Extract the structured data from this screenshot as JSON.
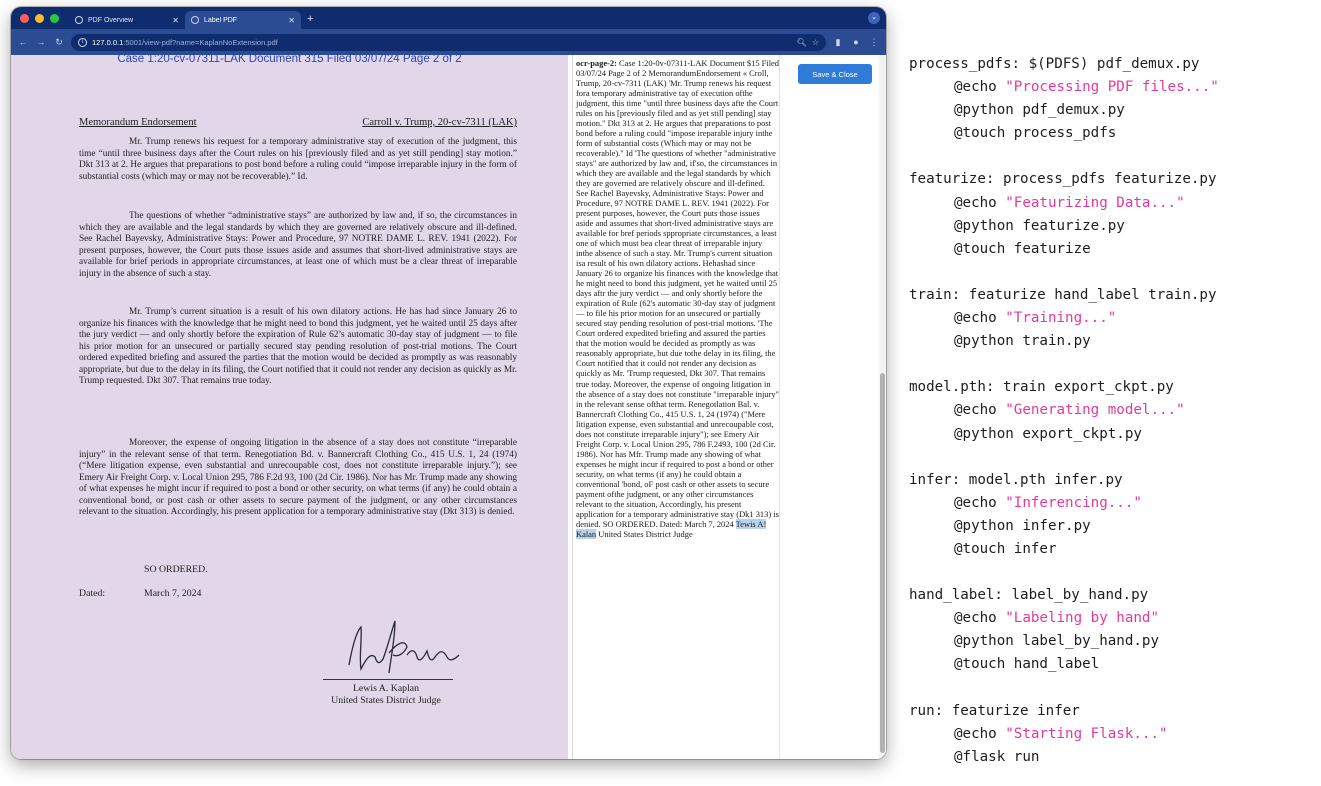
{
  "browser": {
    "tabs": [
      {
        "label": "PDF Overview",
        "active": false
      },
      {
        "label": "Label PDF",
        "active": true
      }
    ],
    "url_host": "127.0.0.1",
    "url_rest": ":5001/view-pdf?name=KaplanNoExtension.pdf",
    "colors": {
      "frame": "#0f2d6e",
      "toolbar": "#2b4c93",
      "accent": "#2f7bd8"
    }
  },
  "pdf": {
    "header": "Case 1:20-cv-07311-LAK   Document 315   Filed 03/07/24   Page 2 of 2",
    "memo_left": "Memorandum Endorsement",
    "memo_right": "Carroll v. Trump, 20-cv-7311 (LAK)",
    "paragraphs": [
      "Mr. Trump renews his request for a temporary administrative stay of execution of the judgment, this time “until three business days after the Court rules on his [previously filed and as yet still pending] stay motion.” Dkt 313 at 2. He argues that preparations to post bond before a ruling could “impose irreparable injury in the form of substantial costs (which may or may not be recoverable).” Id.",
      "The questions of whether “administrative stays” are authorized by law and, if so, the circumstances in which they are available and the legal standards by which they are governed are relatively obscure and ill-defined. See Rachel Bayevsky, Administrative Stays: Power and Procedure, 97 NOTRE DAME L. REV. 1941 (2022). For present purposes, however, the Court puts those issues aside and assumes that short-lived administrative stays are available for brief periods in appropriate circumstances, at least one of which must be a clear threat of irreparable injury in the absence of such a stay.",
      "Mr. Trump’s current situation is a result of his own dilatory actions. He has had since January 26 to organize his finances with the knowledge that he might need to bond this judgment, yet he waited until 25 days after the jury verdict — and only shortly before the expiration of Rule 62’s automatic 30-day stay of judgment — to file his prior motion for an unsecured or partially secured stay pending resolution of post-trial motions. The Court ordered expedited briefing and assured the parties that the motion would be decided as promptly as was reasonably appropriate, but due to the delay in its filing, the Court notified that it could not render any decision as quickly as Mr. Trump requested. Dkt 307. That remains true today.",
      "Moreover, the expense of ongoing litigation in the absence of a stay does not constitute “irreparable injury” in the relevant sense of that term. Renegotiation Bd. v. Bannercraft Clothing Co., 415 U.S. 1, 24 (1974) (“Mere litigation expense, even substantial and unrecoupable cost, does not constitute irreparable injury.”); see Emery Air Freight Corp. v. Local Union 295, 786 F.2d 93, 100 (2d Cir. 1986). Nor has Mr. Trump made any showing of what expenses he might incur if required to post a bond or other security, on what terms (if any) he could obtain a conventional bond, or post cash or other assets to secure payment of the judgment, or any other circumstances relevant to the situation. Accordingly, his present application for a temporary administrative stay (Dkt 313) is denied."
    ],
    "so_ordered": "SO ORDERED.",
    "dated_label": "Dated:",
    "dated_value": "March 7, 2024",
    "judge_name": "Lewis A. Kaplan",
    "judge_title": "United States District Judge",
    "background": "#e2d7e9"
  },
  "ocr": {
    "label": "ocr-page-2:",
    "text": " Case 1:20-0v-07311-LAK Document $15 Filed 03/07/24 Page 2 of 2 MemorandumEndorsement « Croll, Trump, 20-cv-7311 (LAK) 'Mr. Trump renews his request fora temporary administrative tay of execution ofthe judgment, this time \"until three business days afte the Court rules on his [previously filed and as yet still pending] stay motion.\" Dkt 313 at 2. He argues that preparations to post bond before a ruling could \"impose ireparable injury inthe form of substantial costs (Which may or may not be recoverable).\" Id 'The questions of whether \"administrative stays\" are authorized by law and, if'so, the circumstances in which they are available and the legal standards by which they are governed are relatively obscure and ill-defined. See Rachel Bayevsky, Administrative Stays: Power and Procedure, 97 NOTRE DAME L. REV. 1941 (2022). For present purposes, however, the Court puts those issues aside and assumes that short-lived administrative stays are available for bref periods sppropriate circumstances, a least one of which must bea clear threat of irreparable injury inthe absence of such a stay. Mr. Trump's current situation isa result of his own dilatory actions. Hehashad since January 26 to organize his finances with the knowledge that he might need to bond this judgment, yet he waited until 25 days aftr the jury verdict — and only shortly before the expiration of Rule (62's automatic 30-day stay of judgment — to file his prior motion for an unsecured or partially secured stay pending resolution of post-trial motions. 'The Court ordered expedited briefing and assured the parties that the motion would be decided as promptly as was reasonably appropriate, but due tothe delay in its filing, the Court notified that it could not render any decision as quickly as Mr. 'Trump requested, Dkt 307. That remains true today. Moreover, the expense of ongoing litigation in the absence of a stay does not constitute \"irreparable injury\" in the relevant sense ofthat term. Renegotlation Bal. v. Bannercraft Clothing Co., 415 U.S. 1, 24 (1974) (\"Mere litigation expense, even substantial and unrecoupable cost, does not constitute irreparable injury\"); see Emery Air Freight Corp. v. Local Union 295, 786 F.2493, 100 (2d Cir. 1986). Nor has Mfr. Trump made any showing of what expenses he might incur if required to post a bond or other security, on what terms (if any) he could obtain a conventional 'bond, oF post cash or other assets to secure payment ofthe judgment, or any other circumstances relevant to the situation, Accordingly, his present application for a temporary administrative stay (Dk1 313) is denied. SO ORDERED. Dated: March 7, 2024 ",
    "highlight": "Tewis A! Kalan",
    "tail": " United States District Judge",
    "highlight_color": "#b9d3ee"
  },
  "side": {
    "save_label": "Save & Close"
  },
  "makefile": {
    "rules": [
      {
        "target": "process_pdfs: $(PDFS) pdf_demux.py",
        "commands": [
          {
            "pre": "@echo ",
            "str": "\"Processing PDF files...\""
          },
          {
            "pre": "@python pdf_demux.py"
          },
          {
            "pre": "@touch process_pdfs"
          }
        ]
      },
      {
        "target": "featurize: process_pdfs featurize.py",
        "commands": [
          {
            "pre": "@echo ",
            "str": "\"Featurizing Data...\""
          },
          {
            "pre": "@python featurize.py"
          },
          {
            "pre": "@touch featurize"
          }
        ]
      },
      {
        "target": "train: featurize hand_label train.py",
        "commands": [
          {
            "pre": "@echo ",
            "str": "\"Training...\""
          },
          {
            "pre": "@python train.py"
          }
        ]
      },
      {
        "target": "model.pth: train export_ckpt.py",
        "commands": [
          {
            "pre": "@echo ",
            "str": "\"Generating model...\""
          },
          {
            "pre": "@python export_ckpt.py"
          }
        ]
      },
      {
        "target": "infer: model.pth infer.py",
        "commands": [
          {
            "pre": "@echo ",
            "str": "\"Inferencing...\""
          },
          {
            "pre": "@python infer.py"
          },
          {
            "pre": "@touch infer"
          }
        ]
      },
      {
        "target": "hand_label: label_by_hand.py",
        "commands": [
          {
            "pre": "@echo ",
            "str": "\"Labeling by hand\""
          },
          {
            "pre": "@python label_by_hand.py"
          },
          {
            "pre": "@touch hand_label"
          }
        ]
      },
      {
        "target": "run: featurize infer",
        "commands": [
          {
            "pre": "@echo ",
            "str": "\"Starting Flask...\""
          },
          {
            "pre": "@flask run"
          }
        ]
      }
    ],
    "string_color": "#e23a9b"
  }
}
